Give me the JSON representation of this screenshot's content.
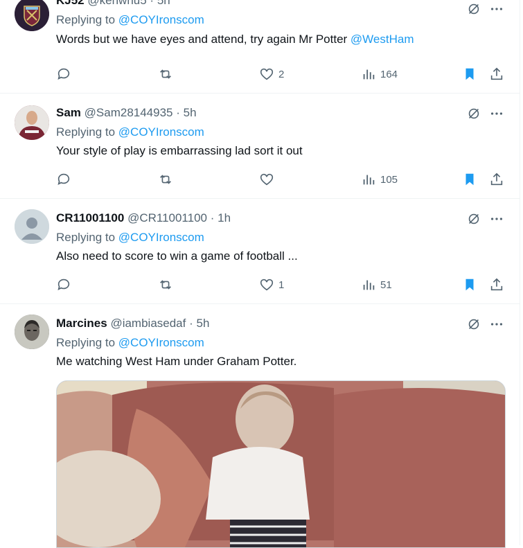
{
  "tweets": [
    {
      "name": "KJ52",
      "handle": "@kenwhu5",
      "time": "5h",
      "replying_label": "Replying to",
      "replying_to": "@COYIronscom",
      "text": "Words but we have eyes and attend, try again Mr Potter",
      "mention": "@WestHam",
      "likes": "2",
      "views": "164",
      "bookmarked": true
    },
    {
      "name": "Sam",
      "handle": "@Sam28144935",
      "time": "5h",
      "replying_label": "Replying to",
      "replying_to": "@COYIronscom",
      "text": "Your style of play is embarrassing lad sort it out",
      "views": "105",
      "bookmarked": true
    },
    {
      "name": "CR11001100",
      "handle": "@CR11001100",
      "time": "1h",
      "replying_label": "Replying to",
      "replying_to": "@COYIronscom",
      "text": "Also need to score to win a game of football ...",
      "likes": "1",
      "views": "51",
      "bookmarked": true
    },
    {
      "name": "Marcines",
      "handle": "@iambiasedaf",
      "time": "5h",
      "replying_label": "Replying to",
      "replying_to": "@COYIronscom",
      "text": "Me watching West Ham under Graham Potter."
    }
  ],
  "colors": {
    "accent": "#1d9bf0",
    "muted": "#536471",
    "text": "#0f1419",
    "border": "#eff3f4"
  },
  "icons": [
    "grok-icon",
    "more-icon",
    "reply-icon",
    "retweet-icon",
    "like-icon",
    "views-icon",
    "bookmark-icon",
    "share-icon"
  ]
}
